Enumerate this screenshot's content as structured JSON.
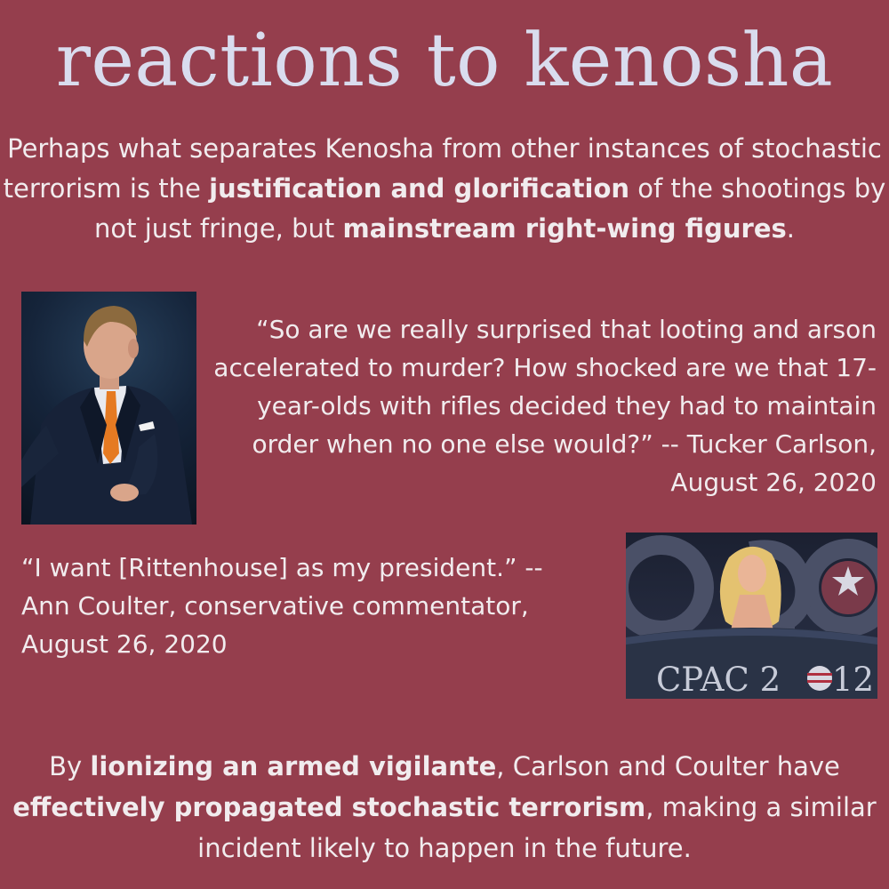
{
  "title": "reactions to kenosha",
  "intro": {
    "part1": "Perhaps what separates Kenosha from other instances of stochastic terrorism is the ",
    "bold1": "justification and glorification",
    "part2": " of the shootings by not just fringe, but ",
    "bold2": "mainstream right-wing figures",
    "part3": "."
  },
  "quote_carlson": "“So are we really surprised that looting and arson accelerated to murder? How shocked are we that 17-year-olds with rifles decided they had to maintain order when no one else would?” -- Tucker Carlson, August 26, 2020",
  "quote_coulter": "“I want [Rittenhouse] as my president.” -- Ann Coulter, conservative commentator, August 26, 2020",
  "coulter_photo": {
    "banner_text": "CPAC 2",
    "banner_tail": "12"
  },
  "outro": {
    "part1": "By ",
    "bold1": "lionizing an armed vigilante",
    "part2": ", Carlson and Coulter have ",
    "bold2": "effectively propagated stochastic terrorism",
    "part3": ", making a similar incident likely to happen in the future."
  },
  "colors": {
    "background": "#953e4d",
    "title": "#d9dcee",
    "text": "#f1ecee"
  }
}
